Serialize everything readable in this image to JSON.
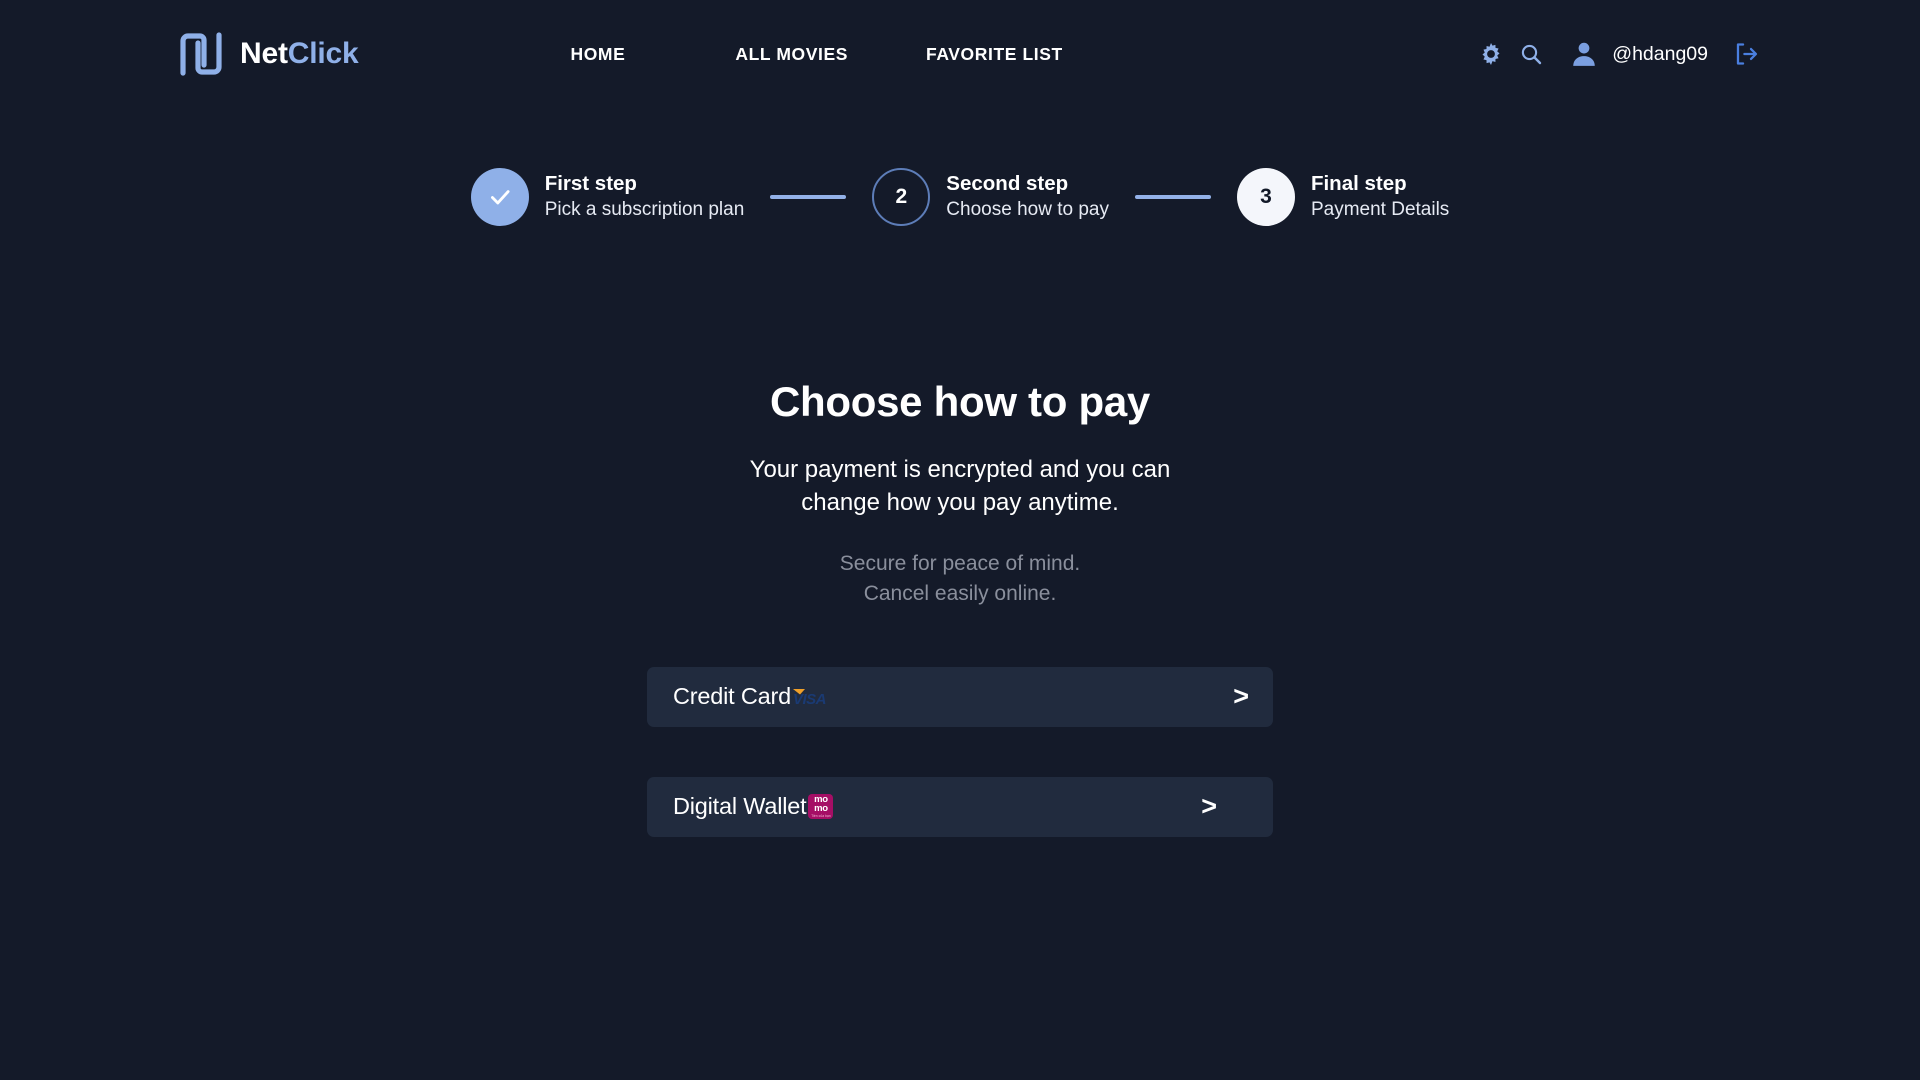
{
  "brand": {
    "logo_icon": "netclick-n-logo",
    "name_part1": "Net",
    "name_part2": "Click"
  },
  "nav": {
    "items": [
      {
        "label": "HOME"
      },
      {
        "label": "ALL MOVIES"
      },
      {
        "label": "FAVORITE LIST"
      }
    ]
  },
  "header_right": {
    "gear_icon": "gear-icon",
    "search_icon": "search-icon",
    "avatar_icon": "user-avatar-icon",
    "username": "@hdang09",
    "logout_icon": "logout-icon"
  },
  "stepper": {
    "steps": [
      {
        "state": "done",
        "marker": "✓",
        "title": "First step",
        "subtitle": "Pick a subscription plan"
      },
      {
        "state": "current",
        "marker": "2",
        "title": "Second step",
        "subtitle": "Choose how to pay"
      },
      {
        "state": "upcoming",
        "marker": "3",
        "title": "Final step",
        "subtitle": "Payment Details"
      }
    ]
  },
  "main": {
    "title": "Choose how to pay",
    "description": "Your payment is encrypted and you can change how you pay anytime.",
    "note_line1": "Secure for peace of mind.",
    "note_line2": "Cancel easily online."
  },
  "payment_options": [
    {
      "label": "Credit Card",
      "badge": "visa-logo",
      "badge_text": "VISA",
      "chevron": ">"
    },
    {
      "label": "Digital Wallet",
      "badge": "momo-logo",
      "badge_text": "mo",
      "badge_text2": "mo",
      "badge_tagline": "Tiền của bạn",
      "chevron": ">"
    }
  ],
  "colors": {
    "background": "#141a29",
    "accent_blue": "#8fb0e8",
    "connector": "#93b1e8",
    "option_bg": "#212b3e",
    "note_text": "#8a8f9c",
    "visa_blue": "#1a3a73",
    "visa_gold": "#f0a02a",
    "momo_pink": "#a50e65"
  }
}
